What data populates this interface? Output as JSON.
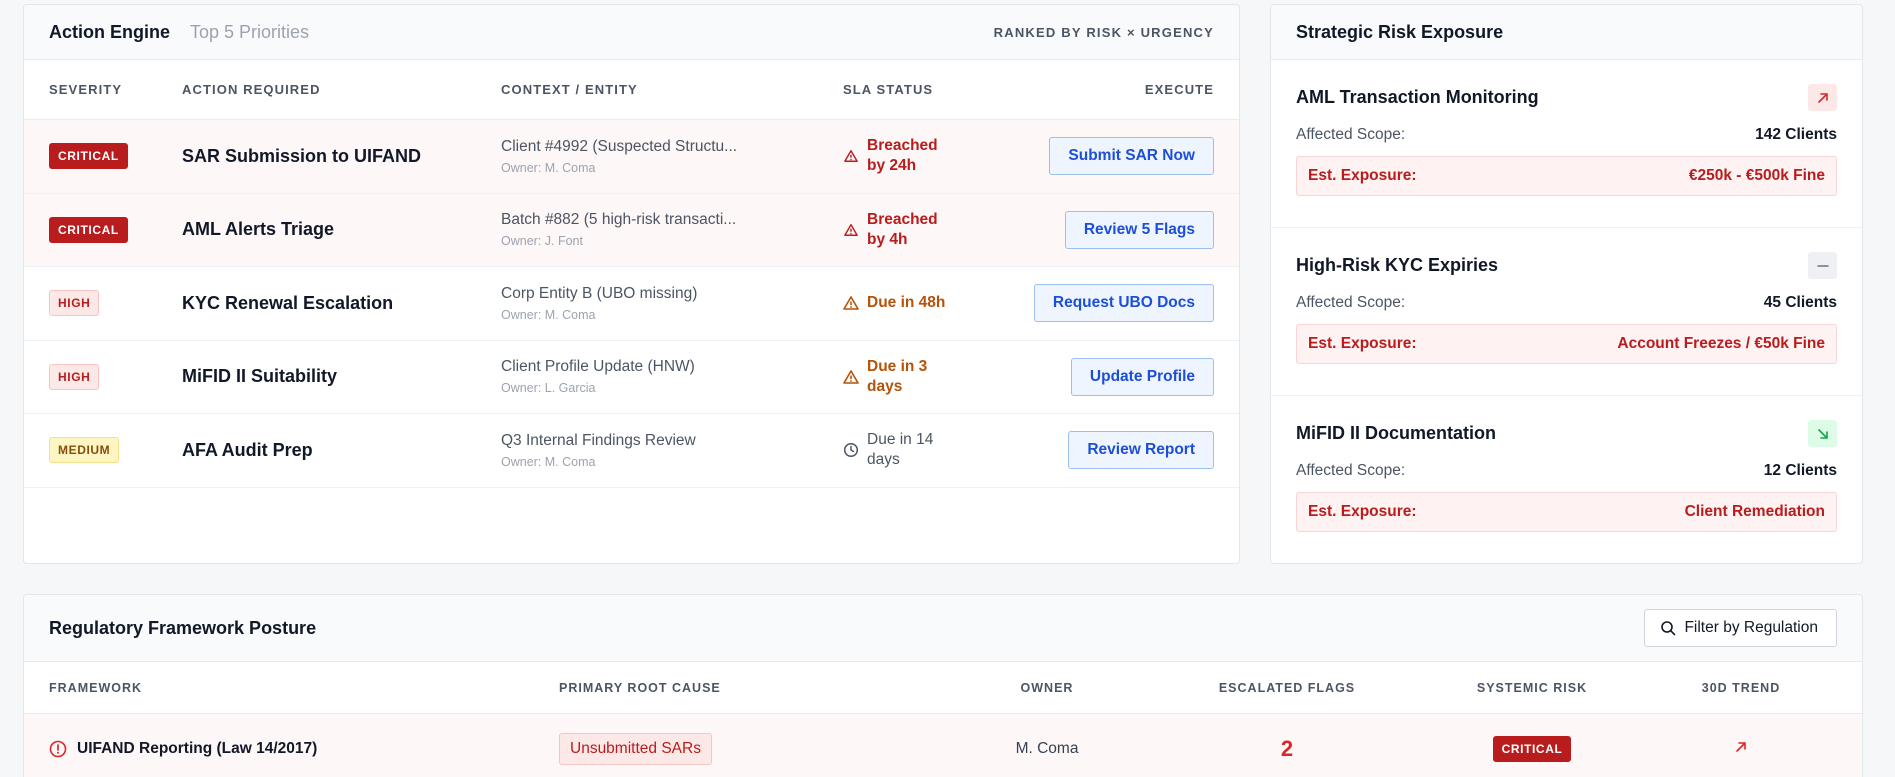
{
  "action_engine": {
    "title": "Action Engine",
    "subtitle": "Top 5 Priorities",
    "ranking_label": "RANKED BY RISK × URGENCY",
    "columns": {
      "severity": "SEVERITY",
      "action": "ACTION REQUIRED",
      "context": "CONTEXT / ENTITY",
      "sla": "SLA STATUS",
      "execute": "EXECUTE"
    },
    "rows": [
      {
        "severity": "CRITICAL",
        "action": "SAR Submission to UIFAND",
        "context": "Client #4992 (Suspected Structu...",
        "owner": "Owner: M. Coma",
        "sla": "Breached by 24h",
        "button": "Submit SAR Now"
      },
      {
        "severity": "CRITICAL",
        "action": "AML Alerts Triage",
        "context": "Batch #882 (5 high-risk transacti...",
        "owner": "Owner: J. Font",
        "sla": "Breached by 4h",
        "button": "Review 5 Flags"
      },
      {
        "severity": "HIGH",
        "action": "KYC Renewal Escalation",
        "context": "Corp Entity B (UBO missing)",
        "owner": "Owner: M. Coma",
        "sla": "Due in 48h",
        "button": "Request UBO Docs"
      },
      {
        "severity": "HIGH",
        "action": "MiFID II Suitability",
        "context": "Client Profile Update (HNW)",
        "owner": "Owner: L. Garcia",
        "sla": "Due in 3 days",
        "button": "Update Profile"
      },
      {
        "severity": "MEDIUM",
        "action": "AFA Audit Prep",
        "context": "Q3 Internal Findings Review",
        "owner": "Owner: M. Coma",
        "sla": "Due in 14 days",
        "button": "Review Report"
      }
    ]
  },
  "strategic_risk": {
    "title": "Strategic Risk Exposure",
    "scope_label": "Affected Scope:",
    "exposure_label": "Est. Exposure:",
    "items": [
      {
        "name": "AML Transaction Monitoring",
        "trend_icon": "arrow-up-right-icon",
        "scope": "142 Clients",
        "exposure": "€250k - €500k Fine"
      },
      {
        "name": "High-Risk KYC Expiries",
        "trend_icon": "dash-icon",
        "scope": "45 Clients",
        "exposure": "Account Freezes / €50k Fine"
      },
      {
        "name": "MiFID II Documentation",
        "trend_icon": "arrow-down-right-icon",
        "scope": "12 Clients",
        "exposure": "Client Remediation"
      }
    ]
  },
  "regulatory": {
    "title": "Regulatory Framework Posture",
    "filter_label": "Filter by Regulation",
    "columns": {
      "framework": "FRAMEWORK",
      "cause": "PRIMARY ROOT CAUSE",
      "owner": "OWNER",
      "flags": "ESCALATED FLAGS",
      "risk": "SYSTEMIC RISK",
      "trend": "30D TREND"
    },
    "rows": [
      {
        "framework": "UIFAND Reporting (Law 14/2017)",
        "cause": "Unsubmitted SARs",
        "owner": "M. Coma",
        "flags": "2",
        "risk": "CRITICAL"
      }
    ]
  },
  "colors": {
    "critical": "#b91c1c",
    "high_bg": "#fde8e8",
    "medium_bg": "#fdf6c3",
    "link_blue": "#1d4ed8",
    "amber": "#b45309"
  }
}
